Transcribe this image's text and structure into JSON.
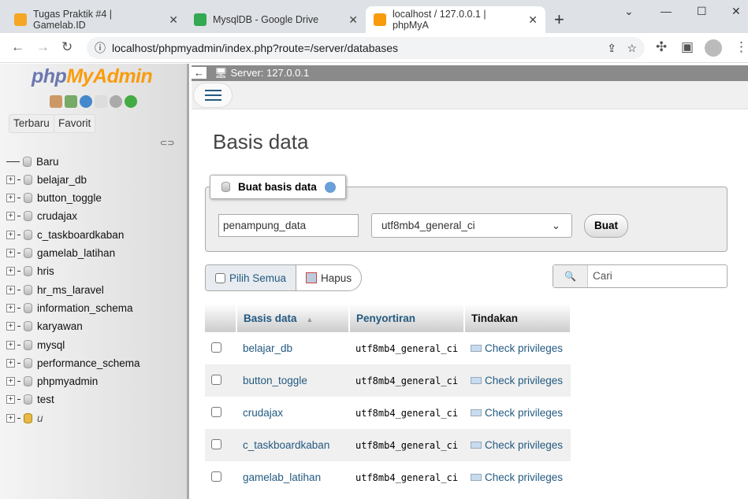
{
  "browser": {
    "tabs": [
      {
        "title": "Tugas Praktik #4 | Gamelab.ID",
        "favicon_color": "#f5a623"
      },
      {
        "title": "MysqlDB - Google Drive",
        "favicon_color": "#34a853"
      },
      {
        "title": "localhost / 127.0.0.1 | phpMyA",
        "favicon_color": "#f89c0e",
        "active": true
      }
    ],
    "url": "localhost/phpmyadmin/index.php?route=/server/databases"
  },
  "sidebar": {
    "logo_php": "php",
    "logo_myadmin": "MyAdmin",
    "recent": "Terbaru",
    "favorites": "Favorit",
    "new": "Baru",
    "databases": [
      "belajar_db",
      "button_toggle",
      "crudajax",
      "c_taskboardkaban",
      "gamelab_latihan",
      "hris",
      "hr_ms_laravel",
      "information_schema",
      "karyawan",
      "mysql",
      "performance_schema",
      "phpmyadmin",
      "test"
    ],
    "last": "u"
  },
  "main": {
    "server": "Server: 127.0.0.1",
    "title": "Basis data",
    "create_legend": "Buat basis data",
    "db_name_value": "penampung_data",
    "collation_value": "utf8mb4_general_ci",
    "create_button": "Buat",
    "select_all": "Pilih Semua",
    "delete": "Hapus",
    "search_placeholder": "Cari",
    "columns": [
      "Basis data",
      "Penyortiran",
      "Tindakan"
    ],
    "rows": [
      {
        "name": "belajar_db",
        "collation": "utf8mb4_general_ci",
        "action": "Check privileges"
      },
      {
        "name": "button_toggle",
        "collation": "utf8mb4_general_ci",
        "action": "Check privileges"
      },
      {
        "name": "crudajax",
        "collation": "utf8mb4_general_ci",
        "action": "Check privileges"
      },
      {
        "name": "c_taskboardkaban",
        "collation": "utf8mb4_general_ci",
        "action": "Check privileges"
      },
      {
        "name": "gamelab_latihan",
        "collation": "utf8mb4_general_ci",
        "action": "Check privileges"
      }
    ]
  }
}
